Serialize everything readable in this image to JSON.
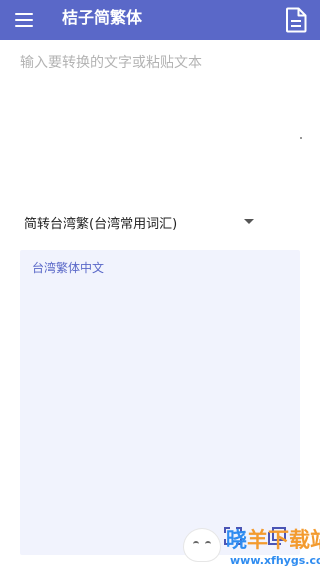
{
  "app": {
    "title": "桔子简繁体"
  },
  "input": {
    "placeholder": "输入要转换的文字或粘贴文本",
    "value": ""
  },
  "conversion": {
    "selected_mode": "简转台湾繁(台湾常用词汇)"
  },
  "output": {
    "text": "台湾繁体中文"
  },
  "watermark": {
    "brand_part1": "晓",
    "brand_part2": "羊下载站",
    "url": "www.xfhygs.com"
  },
  "colors": {
    "primary": "#5a68c8",
    "output_bg": "#f1f3fd",
    "watermark_blue": "#2f8cf0",
    "watermark_orange": "#f39b2f"
  },
  "icons": {
    "menu": "hamburger-icon",
    "document": "document-icon",
    "scan": "scan-icon",
    "copy": "copy-icon",
    "dropdown": "dropdown-arrow-icon"
  }
}
